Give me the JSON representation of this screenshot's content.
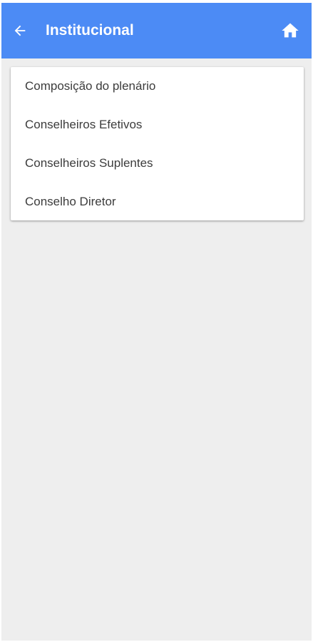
{
  "header": {
    "title": "Institucional",
    "back_icon": "arrow-left-icon",
    "home_icon": "home-icon",
    "color": "#4c8bf5"
  },
  "menu": {
    "items": [
      {
        "label": "Composição do plenário"
      },
      {
        "label": "Conselheiros Efetivos"
      },
      {
        "label": "Conselheiros Suplentes"
      },
      {
        "label": "Conselho Diretor"
      }
    ]
  },
  "colors": {
    "background": "#eeeeee",
    "card": "#ffffff",
    "text": "#3c3c3c"
  }
}
